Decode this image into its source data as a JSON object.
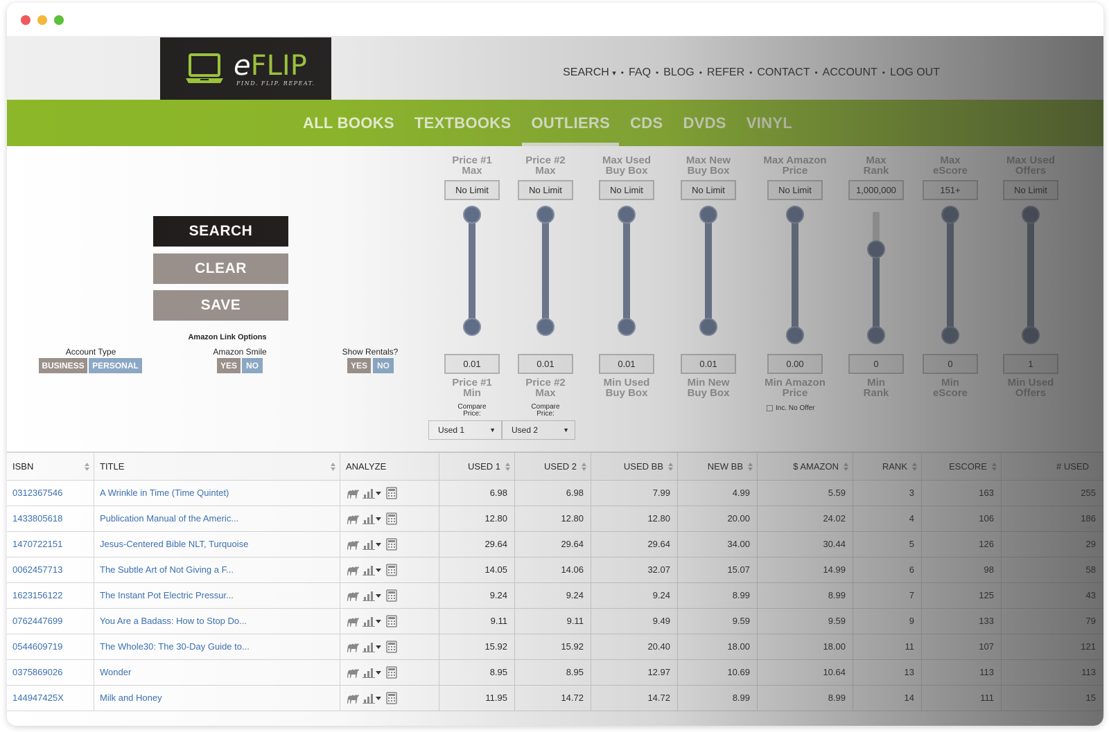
{
  "window": {
    "controls": [
      "close",
      "minimize",
      "zoom"
    ]
  },
  "logo": {
    "brand_prefix": "e",
    "brand_name": "FLIP",
    "tagline": "FIND. FLIP. REPEAT."
  },
  "topnav": {
    "items": [
      "SEARCH",
      "FAQ",
      "BLOG",
      "REFER",
      "CONTACT",
      "ACCOUNT",
      "LOG OUT"
    ],
    "search_caret": "▾",
    "separator": "•"
  },
  "categories": {
    "items": [
      "ALL BOOKS",
      "TEXTBOOKS",
      "OUTLIERS",
      "CDS",
      "DVDS",
      "VINYL"
    ],
    "active": "OUTLIERS"
  },
  "actions": {
    "search_label": "SEARCH",
    "clear_label": "CLEAR",
    "save_label": "SAVE"
  },
  "options": {
    "account_type": {
      "label": "Account Type",
      "business": "BUSINESS",
      "personal": "PERSONAL"
    },
    "amazon_link": {
      "group_label": "Amazon Link Options",
      "label": "Amazon Smile",
      "yes": "YES",
      "no": "NO"
    },
    "rentals": {
      "label": "Show Rentals?",
      "yes": "YES",
      "no": "NO"
    }
  },
  "sliders": [
    {
      "top_label_1": "Price #1",
      "top_label_2": "Max",
      "max_value": "No Limit",
      "min_value": "0.01",
      "bottom_label_1": "Price #1",
      "bottom_label_2": "Min",
      "upper_level": 1.0,
      "lower_level": 0.0,
      "compare_label_1": "Compare",
      "compare_label_2": "Price:",
      "compare_value": "Used 1"
    },
    {
      "top_label_1": "Price #2",
      "top_label_2": "Max",
      "max_value": "No Limit",
      "min_value": "0.01",
      "bottom_label_1": "Price #2",
      "bottom_label_2": "Max",
      "upper_level": 1.0,
      "lower_level": 0.0,
      "compare_label_1": "Compare",
      "compare_label_2": "Price:",
      "compare_value": "Used 2"
    },
    {
      "top_label_1": "Max Used",
      "top_label_2": "Buy Box",
      "max_value": "No Limit",
      "min_value": "0.01",
      "bottom_label_1": "Min Used",
      "bottom_label_2": "Buy Box",
      "upper_level": 1.0,
      "lower_level": 0.0
    },
    {
      "top_label_1": "Max New",
      "top_label_2": "Buy Box",
      "max_value": "No Limit",
      "min_value": "0.01",
      "bottom_label_1": "Min New",
      "bottom_label_2": "Buy Box",
      "upper_level": 1.0,
      "lower_level": 0.0
    },
    {
      "top_label_1": "Max Amazon",
      "top_label_2": "Price",
      "max_value": "No Limit",
      "min_value": "0.00",
      "bottom_label_1": "Min Amazon",
      "bottom_label_2": "Price",
      "upper_level": 1.0,
      "lower_level": 0.0,
      "checkbox_label": "Inc. No Offer"
    },
    {
      "top_label_1": "Max",
      "top_label_2": "Rank",
      "max_value": "1,000,000",
      "min_value": "0",
      "bottom_label_1": "Min",
      "bottom_label_2": "Rank",
      "upper_level": 0.71,
      "lower_level": 0.0
    },
    {
      "top_label_1": "Max",
      "top_label_2": "eScore",
      "max_value": "151+",
      "min_value": "0",
      "bottom_label_1": "Min",
      "bottom_label_2": "eScore",
      "upper_level": 1.0,
      "lower_level": 0.0
    },
    {
      "top_label_1": "Max Used",
      "top_label_2": "Offers",
      "max_value": "No Limit",
      "min_value": "1",
      "bottom_label_1": "Min Used",
      "bottom_label_2": "Offers",
      "upper_level": 1.0,
      "lower_level": 0.0
    }
  ],
  "table": {
    "columns": [
      "ISBN",
      "TITLE",
      "ANALYZE",
      "USED 1",
      "USED 2",
      "USED BB",
      "NEW BB",
      "$ AMAZON",
      "RANK",
      "ESCORE",
      "# USED"
    ],
    "analyze_icons": [
      "camel-icon",
      "bar-chart-icon",
      "dropdown-caret-icon",
      "calculator-icon"
    ],
    "rows": [
      {
        "isbn": "0312367546",
        "title": "A Wrinkle in Time (Time Quintet)",
        "used1": "6.98",
        "used2": "6.98",
        "usedbb": "7.99",
        "newbb": "4.99",
        "amazon": "5.59",
        "rank": "3",
        "escore": "163",
        "used_count": "255"
      },
      {
        "isbn": "1433805618",
        "title": "Publication Manual of the Americ...",
        "used1": "12.80",
        "used2": "12.80",
        "usedbb": "12.80",
        "newbb": "20.00",
        "amazon": "24.02",
        "rank": "4",
        "escore": "106",
        "used_count": "186"
      },
      {
        "isbn": "1470722151",
        "title": "Jesus-Centered Bible NLT, Turquoise",
        "used1": "29.64",
        "used2": "29.64",
        "usedbb": "29.64",
        "newbb": "34.00",
        "amazon": "30.44",
        "rank": "5",
        "escore": "126",
        "used_count": "29"
      },
      {
        "isbn": "0062457713",
        "title": "The Subtle Art of Not Giving a F...",
        "used1": "14.05",
        "used2": "14.06",
        "usedbb": "32.07",
        "newbb": "15.07",
        "amazon": "14.99",
        "rank": "6",
        "escore": "98",
        "used_count": "58"
      },
      {
        "isbn": "1623156122",
        "title": "The Instant Pot Electric Pressur...",
        "used1": "9.24",
        "used2": "9.24",
        "usedbb": "9.24",
        "newbb": "8.99",
        "amazon": "8.99",
        "rank": "7",
        "escore": "125",
        "used_count": "43"
      },
      {
        "isbn": "0762447699",
        "title": "You Are a Badass: How to Stop Do...",
        "used1": "9.11",
        "used2": "9.11",
        "usedbb": "9.49",
        "newbb": "9.59",
        "amazon": "9.59",
        "rank": "9",
        "escore": "133",
        "used_count": "79"
      },
      {
        "isbn": "0544609719",
        "title": "The Whole30: The 30-Day Guide to...",
        "used1": "15.92",
        "used2": "15.92",
        "usedbb": "20.40",
        "newbb": "18.00",
        "amazon": "18.00",
        "rank": "11",
        "escore": "107",
        "used_count": "121"
      },
      {
        "isbn": "0375869026",
        "title": "Wonder",
        "used1": "8.95",
        "used2": "8.95",
        "usedbb": "12.97",
        "newbb": "10.69",
        "amazon": "10.64",
        "rank": "13",
        "escore": "113",
        "used_count": "113"
      },
      {
        "isbn": "144947425X",
        "title": "Milk and Honey",
        "used1": "11.95",
        "used2": "14.72",
        "usedbb": "14.72",
        "newbb": "8.99",
        "amazon": "8.99",
        "rank": "14",
        "escore": "111",
        "used_count": "15"
      }
    ]
  },
  "colors": {
    "brand_green": "#8cb728",
    "logo_bg": "#221f1f",
    "link_blue": "#3a6fb0",
    "slider_track": "#6d7a95",
    "toggle_grey": "#9b918b",
    "toggle_blue": "#8ba9c6"
  }
}
